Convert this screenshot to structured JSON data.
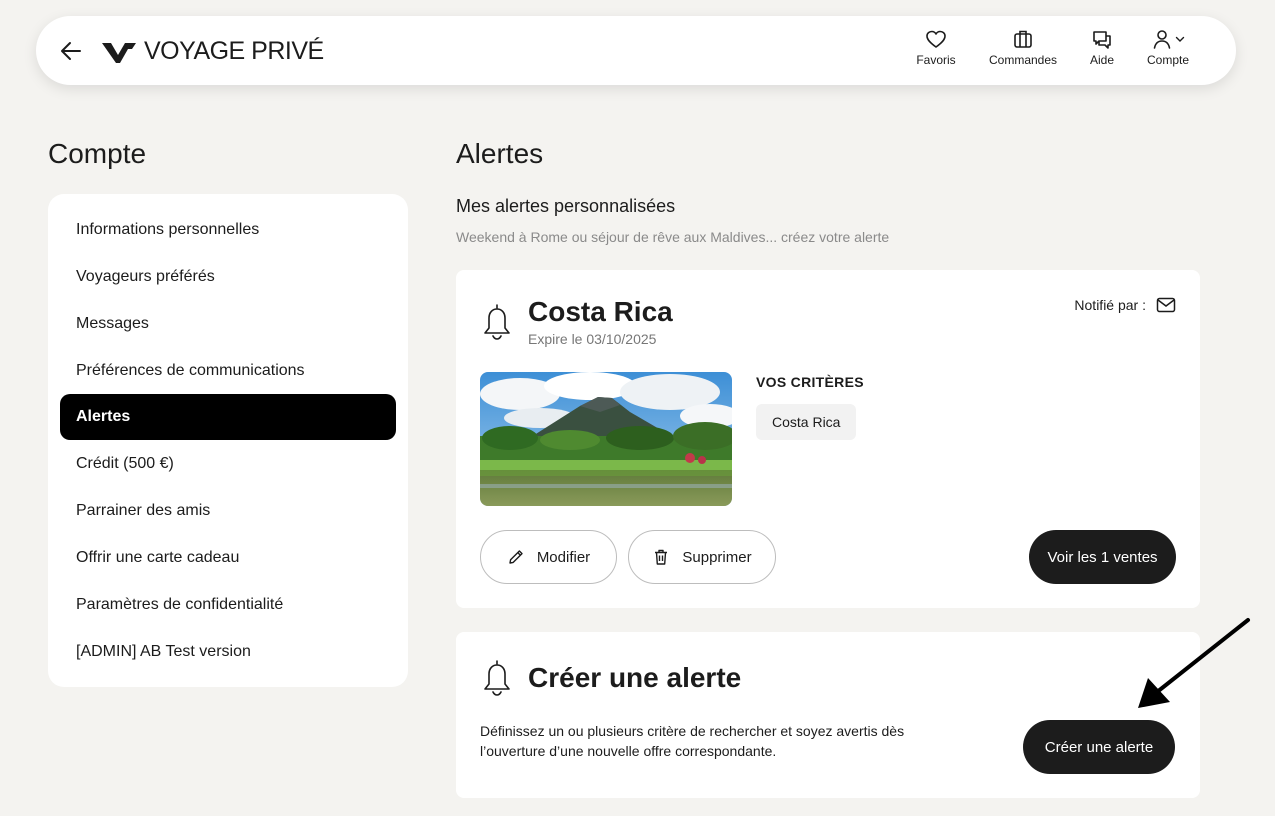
{
  "header": {
    "brand": "VOYAGE PRIVÉ",
    "nav": [
      {
        "label": "Favoris",
        "icon": "heart-icon"
      },
      {
        "label": "Commandes",
        "icon": "suitcase-icon"
      },
      {
        "label": "Aide",
        "icon": "chat-icon"
      },
      {
        "label": "Compte",
        "icon": "user-icon"
      }
    ]
  },
  "sidebar": {
    "title": "Compte",
    "active_index": 4,
    "items": [
      {
        "label": "Informations personnelles"
      },
      {
        "label": "Voyageurs préférés"
      },
      {
        "label": "Messages"
      },
      {
        "label": "Préférences de communications"
      },
      {
        "label": "Alertes"
      },
      {
        "label": "Crédit (500 €)"
      },
      {
        "label": "Parrainer des amis"
      },
      {
        "label": "Offrir une carte cadeau"
      },
      {
        "label": "Paramètres de confidentialité"
      },
      {
        "label": "[ADMIN] AB Test version"
      }
    ]
  },
  "main": {
    "title": "Alertes",
    "section_title": "Mes alertes personnalisées",
    "section_subtitle": "Weekend à Rome ou séjour de rêve aux Maldives... créez votre alerte",
    "alert": {
      "name": "Costa Rica",
      "expires": "Expire le 03/10/2025",
      "notified_by": "Notifié par :",
      "criteria_title": "VOS CRITÈRES",
      "criteria": [
        "Costa Rica"
      ],
      "edit_label": "Modifier",
      "delete_label": "Supprimer",
      "view_label": "Voir les 1 ventes"
    },
    "create": {
      "title": "Créer une alerte",
      "description": "Définissez un ou plusieurs critère de rechercher et soyez avertis dès l’ouverture d’une nouvelle offre correspondante.",
      "button_label": "Créer une alerte"
    }
  },
  "colors": {
    "background": "#f4f3f0",
    "dark": "#1c1c1c",
    "active": "#000000",
    "muted": "#8a8a8a"
  }
}
